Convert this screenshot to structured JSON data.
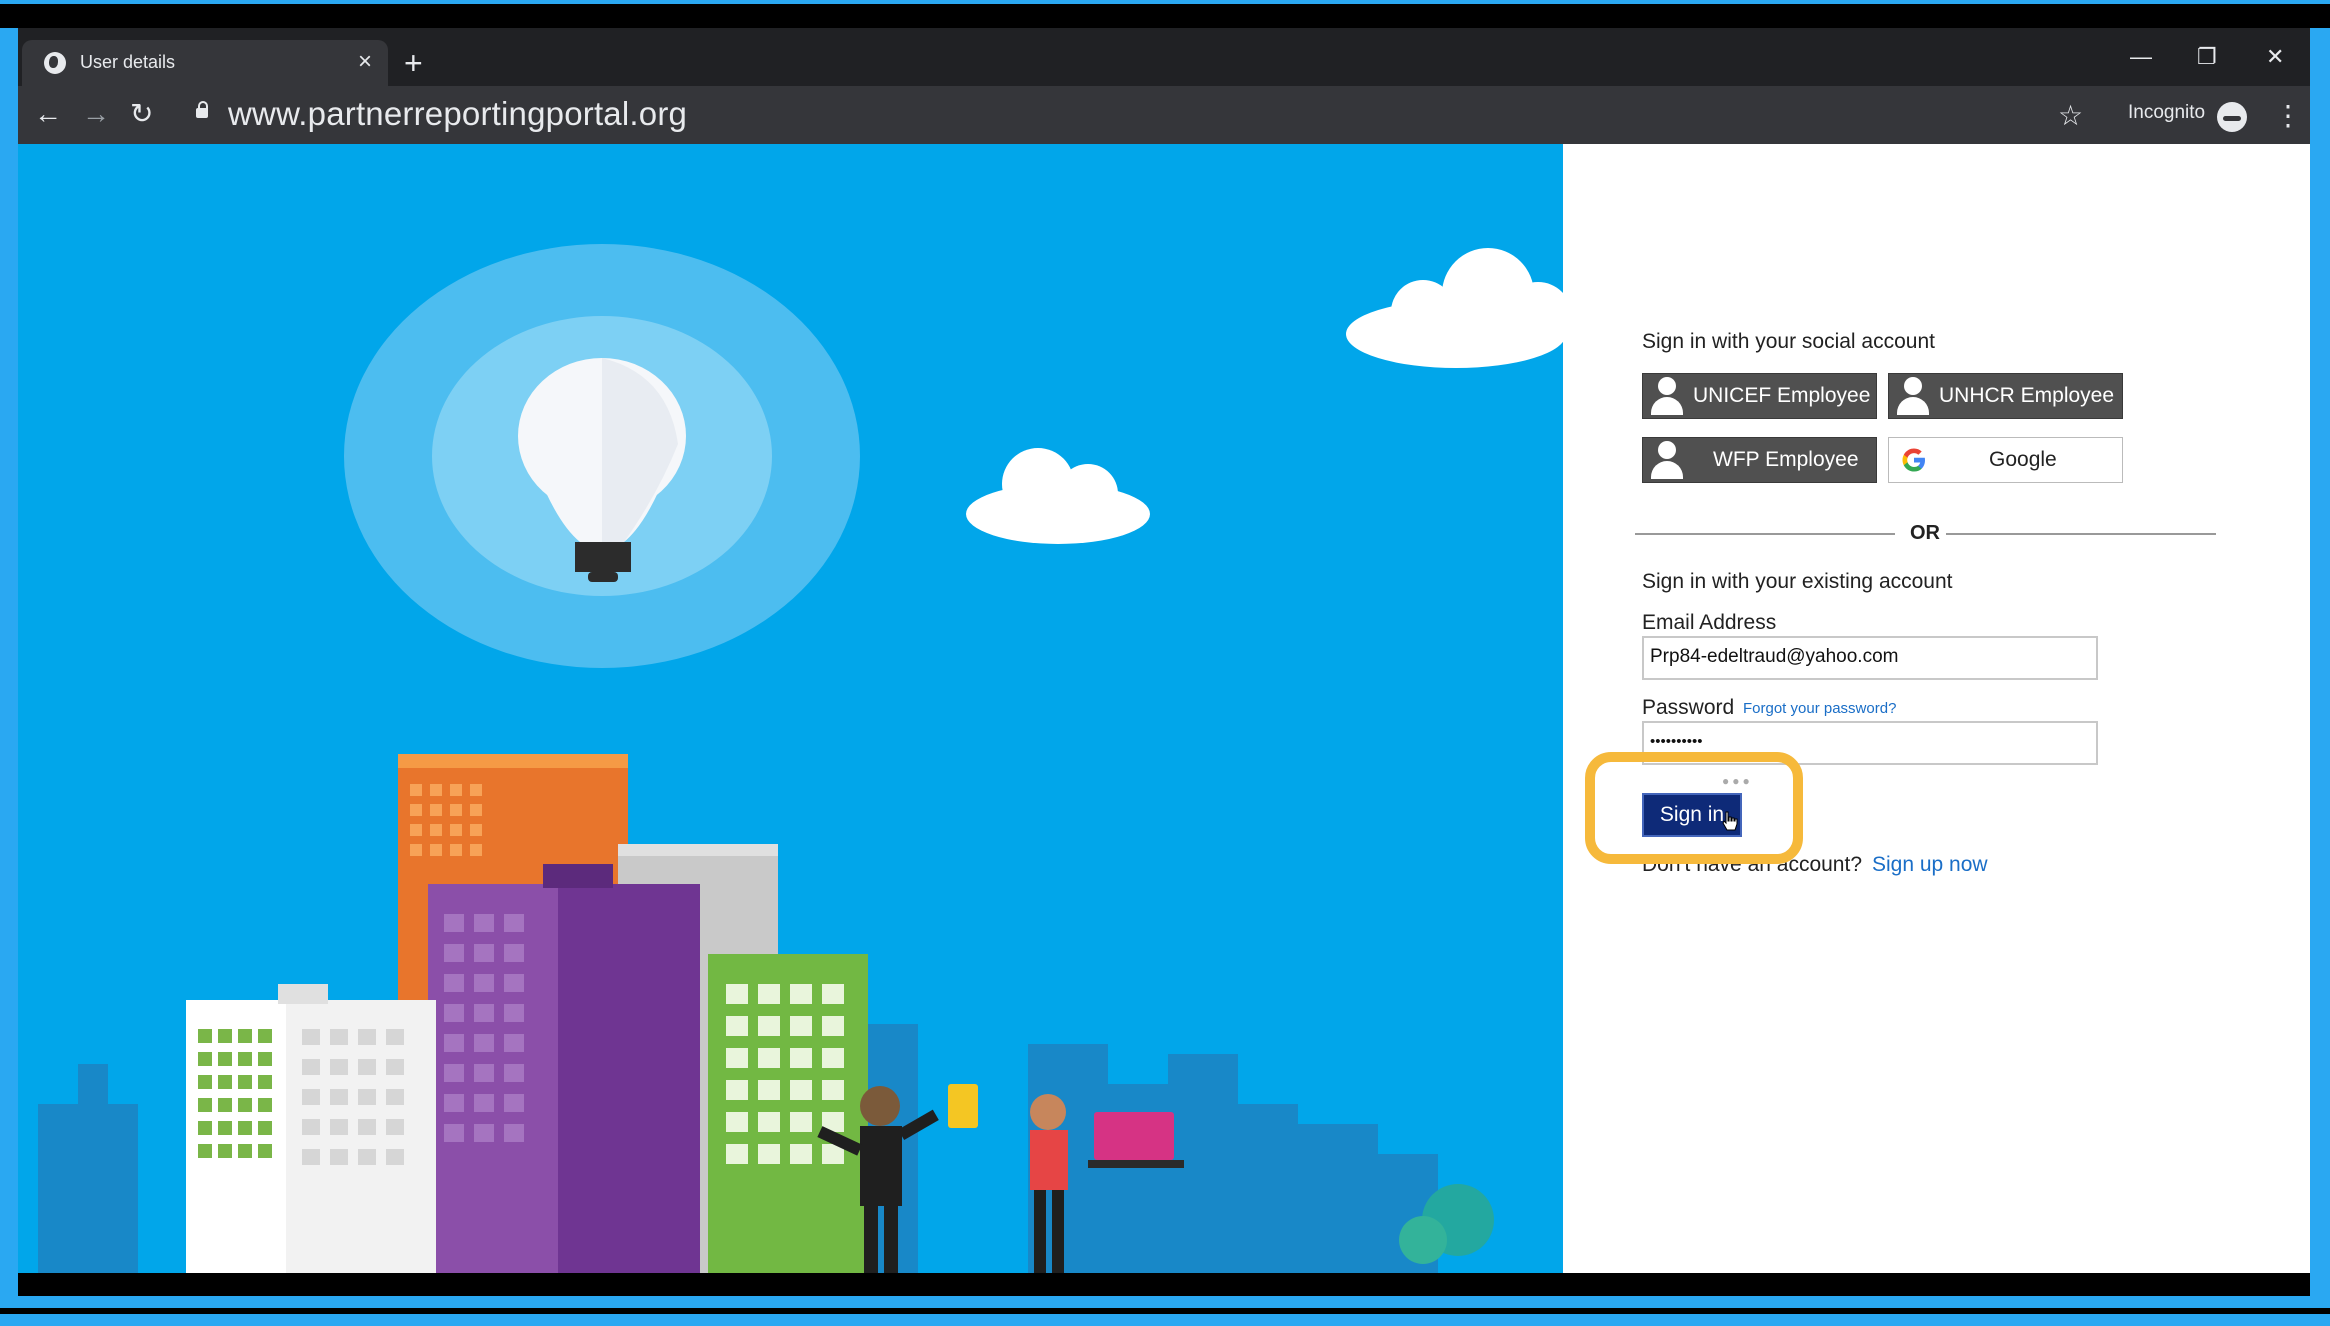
{
  "browser": {
    "tab_title": "User details",
    "url": "www.partnerreportingportal.org",
    "incognito_label": "Incognito",
    "icons": [
      "globe-icon",
      "close-icon",
      "plus-icon",
      "minimize-icon",
      "restore-icon",
      "window-close-icon",
      "back-icon",
      "forward-icon",
      "reload-icon",
      "lock-icon",
      "star-icon",
      "incognito-icon",
      "menu-dots-icon"
    ]
  },
  "signin": {
    "social_heading": "Sign in with your social account",
    "social_buttons": [
      "UNICEF Employee",
      "UNHCR Employee",
      "WFP Employee",
      "Google"
    ],
    "or_label": "OR",
    "existing_heading": "Sign in with your existing account",
    "email_label": "Email Address",
    "email_value": "Prp84-edeltraud@yahoo.com",
    "password_label": "Password",
    "forgot_link": "Forgot your password?",
    "password_value": "••••••••••",
    "submit_label": "Sign in",
    "no_account_text": "Don't have an account?",
    "signup_link": "Sign up now"
  },
  "colors": {
    "hero_blue": "#01a6ea",
    "signin_button": "#0e2a78",
    "highlight": "#f6b93b",
    "link": "#1a6ec7"
  }
}
